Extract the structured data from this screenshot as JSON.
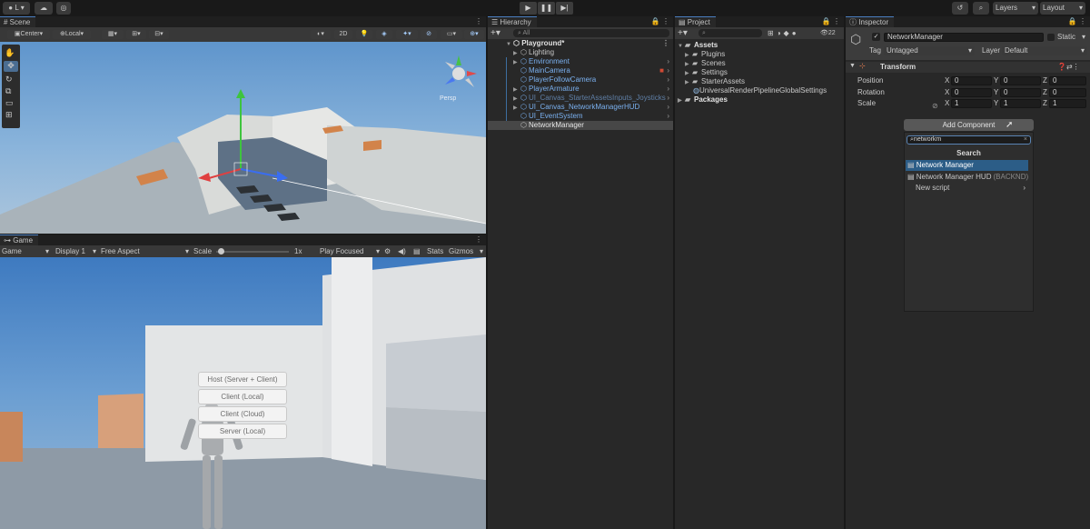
{
  "toolbar": {
    "account_label": "L",
    "layers_label": "Layers",
    "layout_label": "Layout"
  },
  "scene": {
    "tab_label": "Scene",
    "pivot_label": "Center",
    "space_label": "Local",
    "mode_2d_label": "2D",
    "persp_label": "Persp"
  },
  "game": {
    "tab_label": "Game",
    "view_label": "Game",
    "display_label": "Display 1",
    "aspect_label": "Free Aspect",
    "scale_label": "Scale",
    "scale_value": "1x",
    "scale_fraction": 0.04,
    "play_focused_label": "Play Focused",
    "stats_label": "Stats",
    "gizmos_label": "Gizmos",
    "buttons": [
      "Host (Server + Client)",
      "Client (Local)",
      "Client (Cloud)",
      "Server (Local)"
    ]
  },
  "hierarchy": {
    "tab_label": "Hierarchy",
    "search_placeholder": "All",
    "root_label": "Playground*",
    "items": [
      {
        "label": "Lighting",
        "style": "plain",
        "expandable": true
      },
      {
        "label": "Environment",
        "style": "prefab",
        "expandable": true
      },
      {
        "label": "MainCamera",
        "style": "prefab",
        "expandable": false
      },
      {
        "label": "PlayerFollowCamera",
        "style": "prefab",
        "expandable": false
      },
      {
        "label": "PlayerArmature",
        "style": "prefab",
        "expandable": true
      },
      {
        "label": "UI_Canvas_StarterAssetsInputs_Joysticks",
        "style": "dim",
        "expandable": true
      },
      {
        "label": "UI_Canvas_NetworkManagerHUD",
        "style": "prefab",
        "expandable": true
      },
      {
        "label": "UI_EventSystem",
        "style": "prefab",
        "expandable": false
      },
      {
        "label": "NetworkManager",
        "style": "selected",
        "expandable": false
      }
    ]
  },
  "project": {
    "tab_label": "Project",
    "badge_count": "22",
    "assets_label": "Assets",
    "folders": [
      "Plugins",
      "Scenes",
      "Settings",
      "StarterAssets"
    ],
    "asset_file": "UniversalRenderPipelineGlobalSettings",
    "packages_label": "Packages"
  },
  "inspector": {
    "tab_label": "Inspector",
    "object_name": "NetworkManager",
    "static_label": "Static",
    "tag_label": "Tag",
    "tag_value": "Untagged",
    "layer_label": "Layer",
    "layer_value": "Default",
    "transform_label": "Transform",
    "position_label": "Position",
    "rotation_label": "Rotation",
    "scale_label": "Scale",
    "axis_labels": [
      "X",
      "Y",
      "Z"
    ],
    "position": [
      "0",
      "0",
      "0"
    ],
    "rotation": [
      "0",
      "0",
      "0"
    ],
    "scale": [
      "1",
      "1",
      "1"
    ],
    "add_component_label": "Add Component",
    "search_value": "networkm",
    "search_header": "Search",
    "results": [
      "Network Manager",
      "Network Manager HUD",
      "New script"
    ],
    "result_suffix": "(BACKND)"
  },
  "colors": {
    "accent": "#2c5d87",
    "prefab_text": "#7ab0ef",
    "selection": "#2c5d87"
  }
}
